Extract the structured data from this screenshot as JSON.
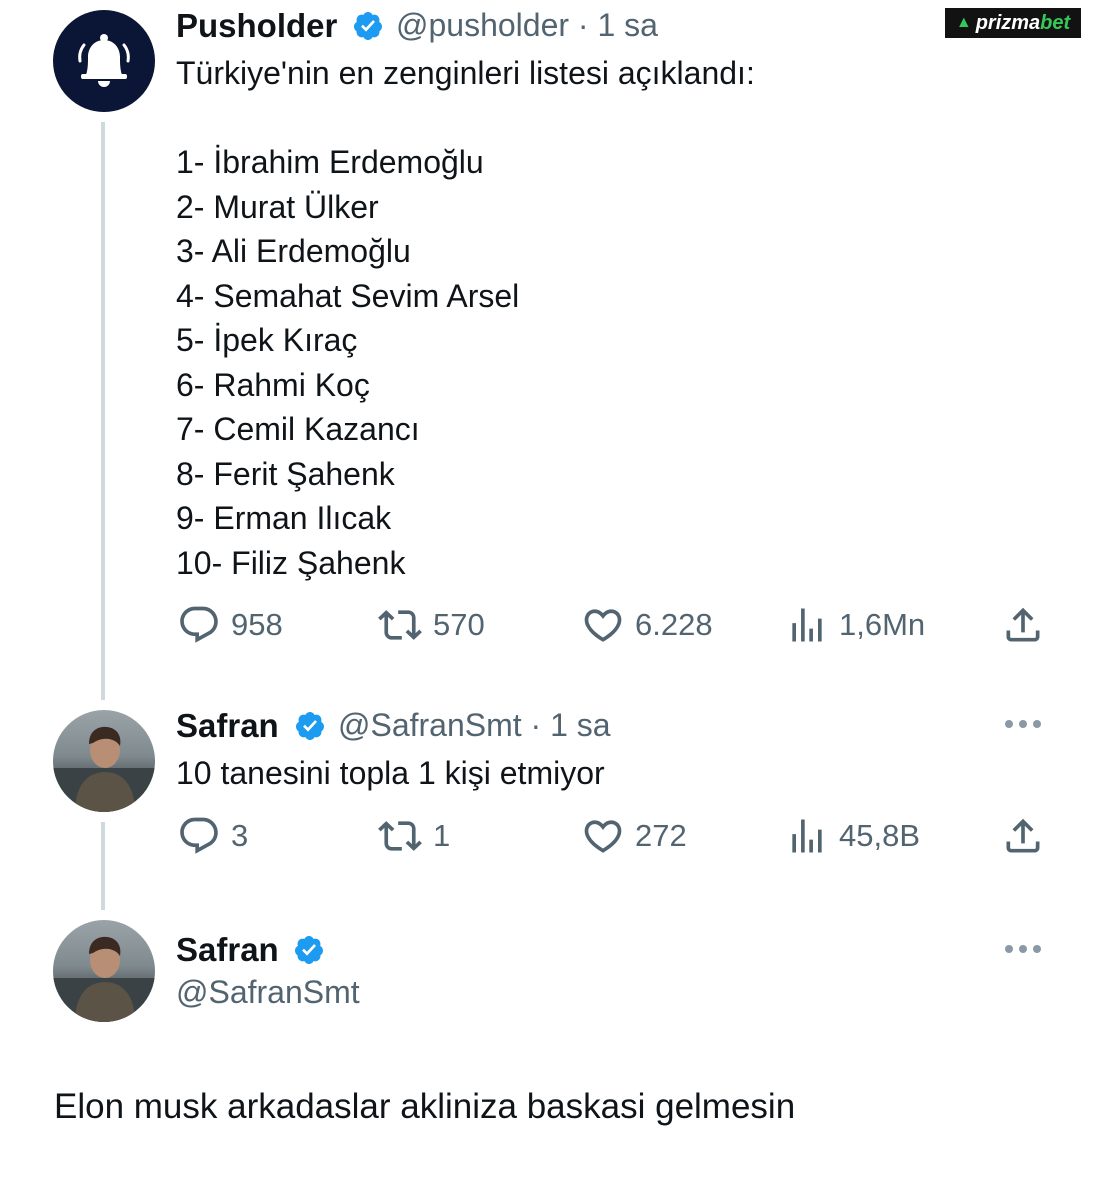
{
  "brand": {
    "name_part1": "prizma",
    "name_part2": "bet",
    "accent": "#34c759"
  },
  "tweet1": {
    "name": "Pusholder",
    "handle": "@pusholder",
    "time": "· 1 sa",
    "text": "Türkiye'nin en zenginleri listesi açıklandı:\n\n1- İbrahim Erdemoğlu\n2- Murat Ülker\n3- Ali Erdemoğlu\n4- Semahat Sevim Arsel\n5- İpek Kıraç\n6- Rahmi Koç\n7- Cemil Kazancı\n8- Ferit Şahenk\n9- Erman Ilıcak\n10- Filiz Şahenk",
    "replies": "958",
    "retweets": "570",
    "likes": "6.228",
    "views": "1,6Mn",
    "avatar_icon": "bell-icon"
  },
  "tweet2": {
    "name": "Safran",
    "handle": "@SafranSmt",
    "time": "· 1 sa",
    "text": "10 tanesini topla 1 kişi etmiyor",
    "replies": "3",
    "retweets": "1",
    "likes": "272",
    "views": "45,8B"
  },
  "tweet3": {
    "name": "Safran",
    "handle": "@SafranSmt",
    "text": "Elon musk arkadaslar akliniza baskasi gelmesin"
  },
  "colors": {
    "verified": "#1d9bf0",
    "muted": "#536471",
    "text": "#0f1419",
    "thread": "#cfd9de"
  }
}
